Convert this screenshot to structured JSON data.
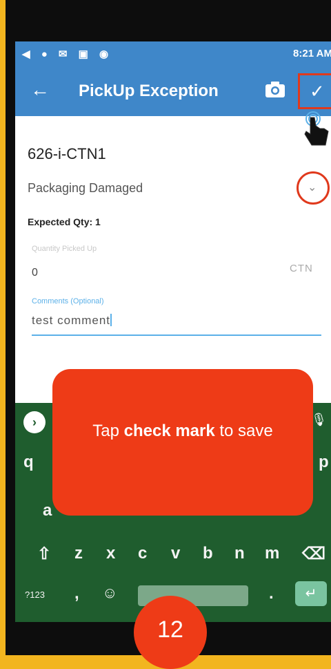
{
  "statusbar": {
    "time": "8:21 AM"
  },
  "appbar": {
    "title": "PickUp Exception"
  },
  "form": {
    "item_id": "626-i-CTN1",
    "reason": "Packaging Damaged",
    "expected_qty": "Expected Qty: 1",
    "qty_label": "Quantity Picked Up",
    "qty_value": "0",
    "unit": "CTN",
    "comments_label": "Comments (Optional)",
    "comments_value": "test comment"
  },
  "keyboard": {
    "row1": [
      "q",
      "p"
    ],
    "row2": [
      "a"
    ],
    "row3": [
      "z",
      "x",
      "c",
      "v",
      "b",
      "n",
      "m"
    ],
    "symbols_label": "?123",
    "comma": ",",
    "period": "."
  },
  "callout": {
    "pre": "Tap ",
    "bold": "check mark",
    "post": " to save"
  },
  "step": {
    "number": "12"
  },
  "colors": {
    "accent": "#3f87c9",
    "highlight": "#ee3b17",
    "keyboard_bg": "#1f5d2e"
  }
}
